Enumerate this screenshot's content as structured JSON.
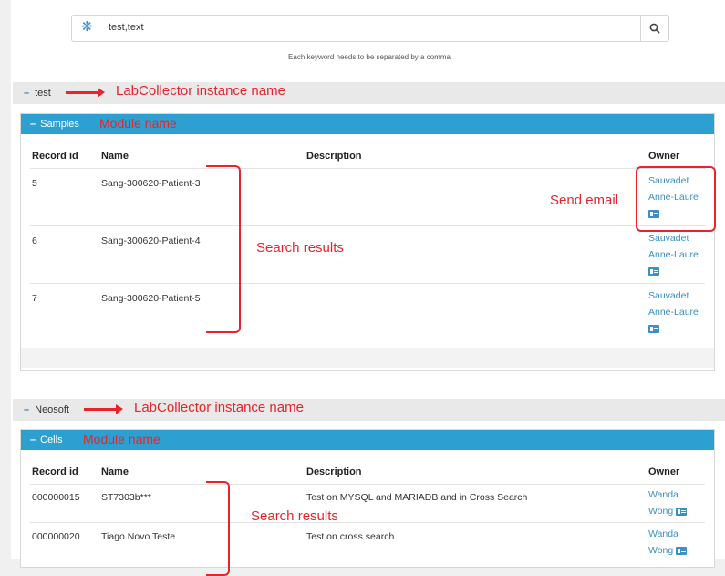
{
  "search": {
    "value": "test,text",
    "hint": "Each keyword needs to be separated by a comma"
  },
  "instances": [
    {
      "name": "test",
      "annotation": "LabCollector instance name",
      "module": {
        "name": "Samples",
        "annotation": "Module name",
        "headers": [
          "Record id",
          "Name",
          "Description",
          "Owner"
        ],
        "rows": [
          {
            "id": "5",
            "name": "Sang-300620-Patient-3",
            "description": "",
            "owner_first": "Sauvadet",
            "owner_last": "Anne-Laure"
          },
          {
            "id": "6",
            "name": "Sang-300620-Patient-4",
            "description": "",
            "owner_first": "Sauvadet",
            "owner_last": "Anne-Laure"
          },
          {
            "id": "7",
            "name": "Sang-300620-Patient-5",
            "description": "",
            "owner_first": "Sauvadet",
            "owner_last": "Anne-Laure"
          }
        ],
        "results_annotation": "Search results",
        "email_annotation": "Send email"
      }
    },
    {
      "name": "Neosoft",
      "annotation": "LabCollector instance name",
      "module": {
        "name": "Cells",
        "annotation": "Module name",
        "headers": [
          "Record id",
          "Name",
          "Description",
          "Owner"
        ],
        "rows": [
          {
            "id": "000000015",
            "name": "ST7303b***",
            "description": "Test on MYSQL and MARIADB and in Cross Search",
            "owner_first": "Wanda",
            "owner_last": "Wong"
          },
          {
            "id": "000000020",
            "name": "Tiago Novo Teste",
            "description": "Test on cross search",
            "owner_first": "Wanda",
            "owner_last": "Wong"
          }
        ],
        "results_annotation": "Search results"
      }
    }
  ],
  "colors": {
    "accent": "#2d9fd0",
    "link": "#3a8fc4",
    "annotation": "#e8242a"
  }
}
